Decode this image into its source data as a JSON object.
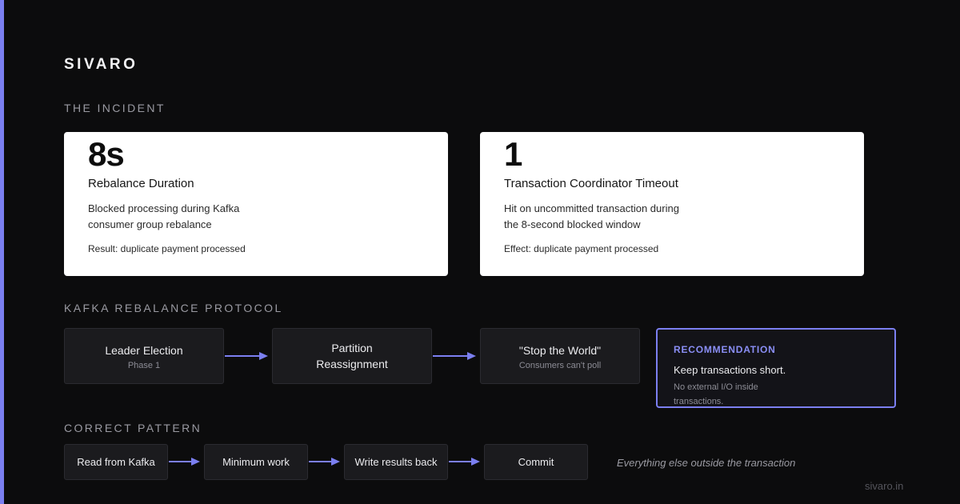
{
  "brand": "SIVARO",
  "incident": {
    "label": "THE INCIDENT",
    "cards": [
      {
        "value": "8s",
        "title": "Rebalance Duration",
        "desc_line1": "Blocked processing during Kafka",
        "desc_line2": "consumer group rebalance",
        "result": "Result: duplicate payment processed"
      },
      {
        "value": "1",
        "title": "Transaction Coordinator Timeout",
        "desc_line1": "Hit on uncommitted transaction during",
        "desc_line2": "the 8-second blocked window",
        "result": "Effect: duplicate payment processed"
      }
    ]
  },
  "protocol": {
    "label": "KAFKA REBALANCE PROTOCOL",
    "steps": [
      {
        "main": "Leader Election",
        "sub": "Phase 1"
      },
      {
        "main": "Partition",
        "main2": "Reassignment"
      },
      {
        "main": "\"Stop the World\"",
        "sub": "Consumers can't poll"
      }
    ],
    "recommendation": {
      "title": "RECOMMENDATION",
      "main": "Keep transactions short.",
      "sub": "No external I/O inside transactions."
    }
  },
  "pattern": {
    "label": "CORRECT PATTERN",
    "steps": [
      "Read from Kafka",
      "Minimum work",
      "Write results back",
      "Commit"
    ],
    "note": "Everything else outside the transaction"
  },
  "footer": {
    "url": "sivaro.in"
  },
  "colors": {
    "accent": "#7b7ff0",
    "background": "#0c0c0d",
    "card": "#ffffff"
  }
}
